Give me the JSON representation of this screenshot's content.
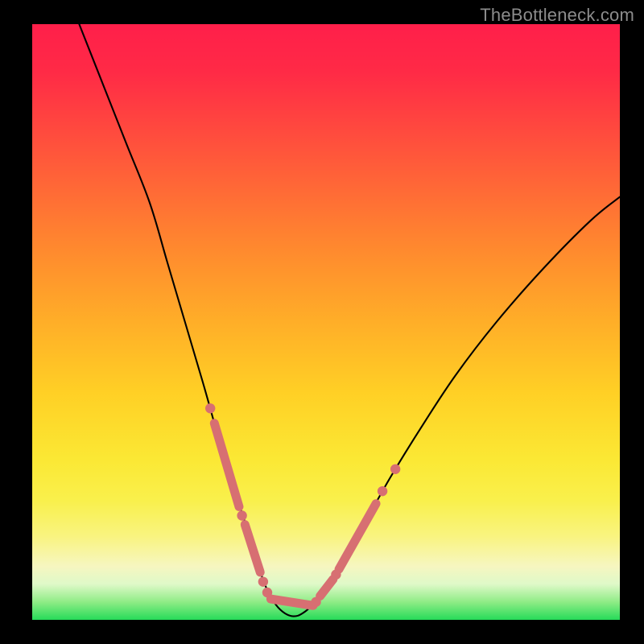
{
  "watermark": "TheBottleneck.com",
  "chart_data": {
    "type": "line",
    "title": "",
    "xlabel": "",
    "ylabel": "",
    "xlim": [
      0,
      100
    ],
    "ylim": [
      0,
      100
    ],
    "curve": {
      "comment": "x,y points (0..100 scale, y=0 bottom) tracing the V-shaped black curve",
      "points": [
        [
          8,
          100
        ],
        [
          12,
          90
        ],
        [
          16,
          80
        ],
        [
          20,
          70
        ],
        [
          23,
          60
        ],
        [
          26,
          50
        ],
        [
          29,
          40
        ],
        [
          31,
          33
        ],
        [
          33,
          26
        ],
        [
          35,
          20
        ],
        [
          37,
          14
        ],
        [
          38.5,
          9
        ],
        [
          40,
          5
        ],
        [
          41.5,
          2.5
        ],
        [
          43,
          1.1
        ],
        [
          44.5,
          0.6
        ],
        [
          46,
          1.1
        ],
        [
          48,
          2.8
        ],
        [
          50.5,
          6
        ],
        [
          53.5,
          11
        ],
        [
          57,
          17
        ],
        [
          61,
          24
        ],
        [
          66,
          32
        ],
        [
          72,
          41
        ],
        [
          79,
          50
        ],
        [
          87,
          59
        ],
        [
          95,
          67
        ],
        [
          100,
          71
        ]
      ]
    },
    "marker_color": "#d76f72",
    "marker_segments": [
      {
        "from": [
          31.0,
          33.0
        ],
        "to": [
          35.2,
          19.0
        ]
      },
      {
        "from": [
          36.2,
          16.0
        ],
        "to": [
          38.8,
          8.0
        ]
      },
      {
        "from": [
          40.6,
          3.5
        ],
        "to": [
          47.8,
          2.4
        ]
      },
      {
        "from": [
          49.0,
          4.0
        ],
        "to": [
          51.2,
          6.8
        ]
      },
      {
        "from": [
          52.2,
          8.5
        ],
        "to": [
          58.5,
          19.5
        ]
      }
    ],
    "marker_dots": [
      [
        30.3,
        35.5
      ],
      [
        35.7,
        17.5
      ],
      [
        39.3,
        6.4
      ],
      [
        40.0,
        4.6
      ],
      [
        48.3,
        3.0
      ],
      [
        51.7,
        7.6
      ],
      [
        59.6,
        21.6
      ],
      [
        61.8,
        25.3
      ]
    ]
  }
}
